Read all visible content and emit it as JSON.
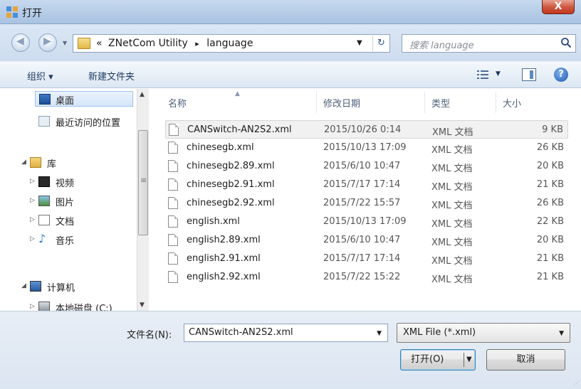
{
  "window": {
    "title": "打开",
    "close_label": "X"
  },
  "address": {
    "prefix": "«",
    "crumbs": [
      "ZNetCom Utility",
      "language"
    ],
    "separator": "▸",
    "search_placeholder": "搜索 language"
  },
  "toolbar": {
    "organize_label": "组织 ▾",
    "new_folder_label": "新建文件夹"
  },
  "nav": {
    "items": [
      {
        "label": "桌面",
        "icon": "desktop-icon"
      },
      {
        "label": "最近访问的位置",
        "icon": "recent-places-icon"
      },
      {
        "label": "库",
        "icon": "library-icon"
      },
      {
        "label": "视频",
        "icon": "video-icon"
      },
      {
        "label": "图片",
        "icon": "pictures-icon"
      },
      {
        "label": "文档",
        "icon": "documents-icon"
      },
      {
        "label": "音乐",
        "icon": "music-icon"
      },
      {
        "label": "计算机",
        "icon": "computer-icon"
      },
      {
        "label": "本地磁盘 (C:)",
        "icon": "drive-icon"
      }
    ]
  },
  "columns": {
    "name": "名称",
    "date": "修改日期",
    "type": "类型",
    "size": "大小"
  },
  "files": [
    {
      "name": "CANSwitch-AN2S2.xml",
      "date": "2015/10/26 0:14",
      "type": "XML 文档",
      "size": "9 KB",
      "selected": true
    },
    {
      "name": "chinesegb.xml",
      "date": "2015/10/13 17:09",
      "type": "XML 文档",
      "size": "26 KB"
    },
    {
      "name": "chinesegb2.89.xml",
      "date": "2015/6/10 10:47",
      "type": "XML 文档",
      "size": "20 KB"
    },
    {
      "name": "chinesegb2.91.xml",
      "date": "2015/7/17 17:14",
      "type": "XML 文档",
      "size": "21 KB"
    },
    {
      "name": "chinesegb2.92.xml",
      "date": "2015/7/22 15:57",
      "type": "XML 文档",
      "size": "26 KB"
    },
    {
      "name": "english.xml",
      "date": "2015/10/13 17:09",
      "type": "XML 文档",
      "size": "22 KB"
    },
    {
      "name": "english2.89.xml",
      "date": "2015/6/10 10:47",
      "type": "XML 文档",
      "size": "20 KB"
    },
    {
      "name": "english2.91.xml",
      "date": "2015/7/17 17:14",
      "type": "XML 文档",
      "size": "21 KB"
    },
    {
      "name": "english2.92.xml",
      "date": "2015/7/22 15:22",
      "type": "XML 文档",
      "size": "21 KB"
    }
  ],
  "bottom": {
    "filename_label": "文件名(N):",
    "filename_value": "CANSwitch-AN2S2.xml",
    "filetype_value": "XML File (*.xml)",
    "open_label": "打开(O)",
    "cancel_label": "取消"
  }
}
